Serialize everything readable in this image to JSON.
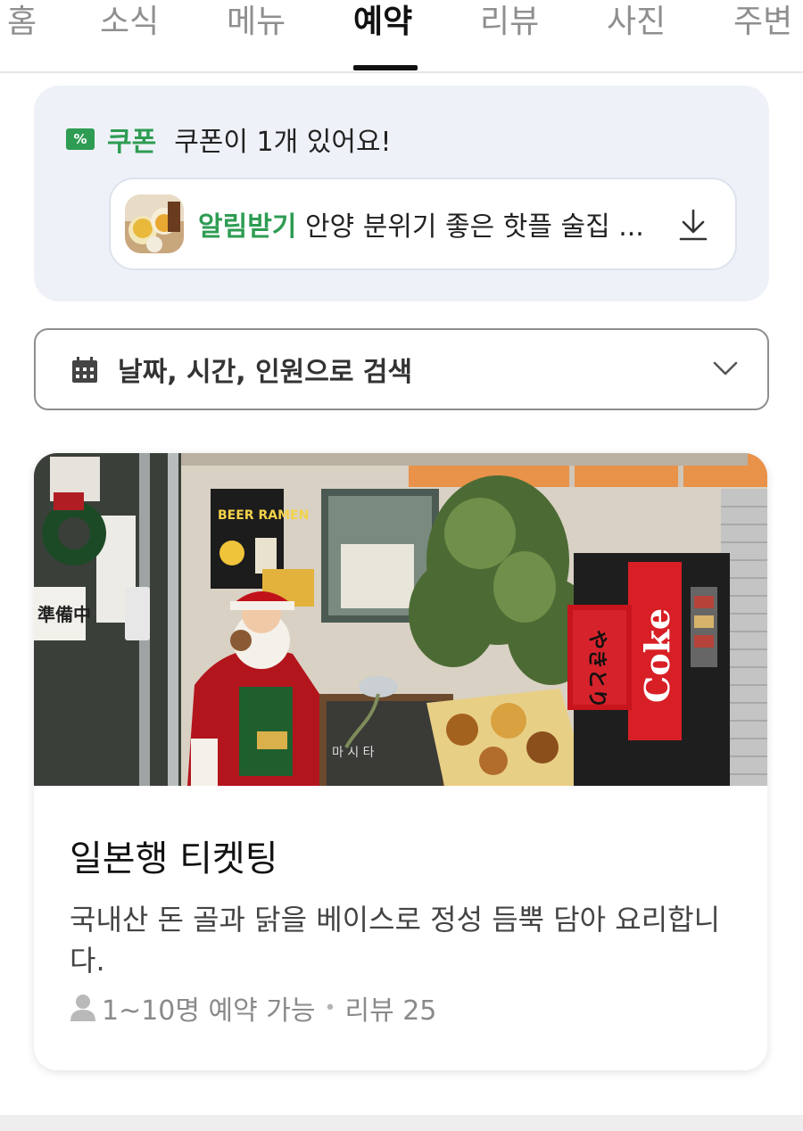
{
  "tabs": [
    {
      "label": "홈",
      "active": false
    },
    {
      "label": "소식",
      "active": false
    },
    {
      "label": "메뉴",
      "active": false
    },
    {
      "label": "예약",
      "active": true
    },
    {
      "label": "리뷰",
      "active": false
    },
    {
      "label": "사진",
      "active": false
    },
    {
      "label": "주변",
      "active": false
    }
  ],
  "coupon": {
    "badge": "%",
    "label": "쿠폰",
    "count_text": "쿠폰이 1개 있어요!",
    "item": {
      "alert_label": "알림받기",
      "title": "안양 분위기 좋은 핫플 술집 ...",
      "thumbnail": "beer-photo",
      "action_icon": "download-icon"
    }
  },
  "search": {
    "icon": "calendar-icon",
    "label": "날짜, 시간, 인원으로 검색",
    "dropdown_icon": "chevron-down-icon"
  },
  "ticket": {
    "image": "restaurant-storefront-photo",
    "image_texts": [
      "BEER RAMEN",
      "準備中",
      "Coke",
      "やきとり"
    ],
    "title": "일본행 티켓팅",
    "description": "국내산 돈 골과 닭을 베이스로 정성 듬뿍 담아 요리합니다.",
    "capacity": "1~10명 예약 가능",
    "review_count": "리뷰 25"
  },
  "colors": {
    "accent_green": "#2e9c53",
    "panel_bg": "#eef2f8",
    "tab_inactive": "#8f8f8f",
    "coke_red": "#d81f26"
  }
}
